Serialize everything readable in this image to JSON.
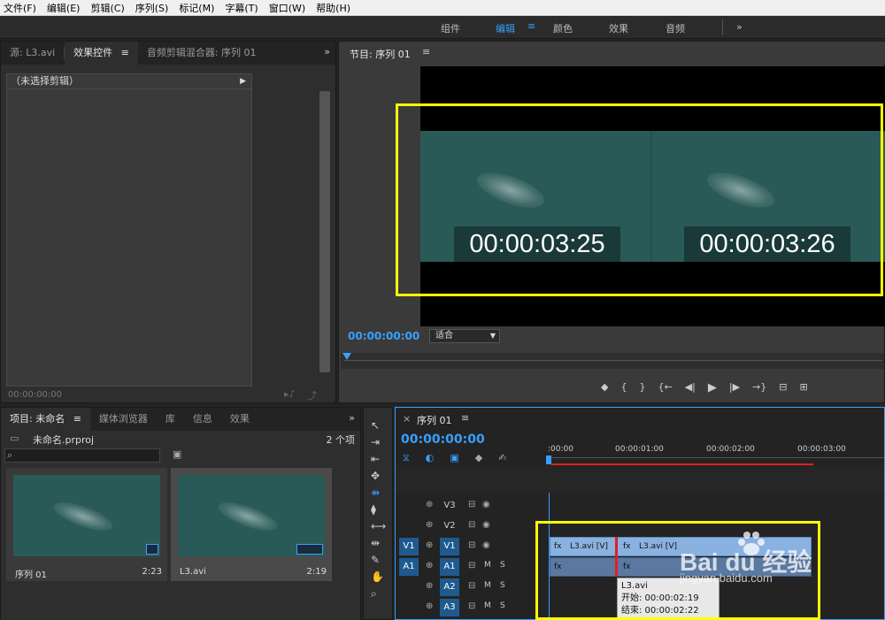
{
  "menu": [
    "文件(F)",
    "编辑(E)",
    "剪辑(C)",
    "序列(S)",
    "标记(M)",
    "字幕(T)",
    "窗口(W)",
    "帮助(H)"
  ],
  "workspaces": {
    "items": [
      "组件",
      "编辑",
      "颜色",
      "效果",
      "音频"
    ],
    "active": "编辑",
    "more": "»"
  },
  "source_panel": {
    "tabs": [
      "源: L3.avi",
      "效果控件",
      "音频剪辑混合器: 序列 01"
    ],
    "active_tab": "效果控件",
    "no_clip": "（未选择剪辑）",
    "timecode": "00:00:00:00",
    "more": "»",
    "menu_glyph": "≡"
  },
  "program_panel": {
    "title": "节目: 序列 01",
    "menu_glyph": "≡",
    "timecode": "00:00:00:00",
    "fit": "适合",
    "overlay_left": "00:00:03:25",
    "overlay_right": "00:00:03:26",
    "highlight_color": "#ffff00"
  },
  "project_panel": {
    "tabs": [
      "项目: 未命名",
      "媒体浏览器",
      "库",
      "信息",
      "效果"
    ],
    "active_tab": "项目: 未命名",
    "file": "未命名.prproj",
    "count": "2 个项",
    "more": "»",
    "menu_glyph": "≡",
    "items": [
      {
        "name": "序列 01",
        "duration": "2:23"
      },
      {
        "name": "L3.avi",
        "duration": "2:19"
      }
    ]
  },
  "timeline": {
    "close": "×",
    "menu_glyph": "≡",
    "title": "序列 01",
    "timecode": "00:00:00:00",
    "ruler": [
      ":00:00",
      "00:00:01:00",
      "00:00:02:00",
      "00:00:03:00"
    ],
    "tracks": [
      {
        "src": "",
        "name": "V3",
        "m": "",
        "s": ""
      },
      {
        "src": "",
        "name": "V2",
        "m": "",
        "s": ""
      },
      {
        "src": "V1",
        "name": "V1",
        "m": "",
        "s": ""
      },
      {
        "src": "A1",
        "name": "A1",
        "m": "M",
        "s": "S"
      },
      {
        "src": "",
        "name": "A2",
        "m": "M",
        "s": "S"
      },
      {
        "src": "",
        "name": "A3",
        "m": "M",
        "s": "S"
      }
    ],
    "clips": {
      "v1_a": "L3.avi [V]",
      "v1_b": "L3.avi [V]",
      "fx": "fx"
    },
    "tooltip": {
      "name": "L3.avi",
      "start": "开始: 00:00:02:19",
      "end": "结束: 00:00:02:22"
    },
    "accent": "#37a0ff",
    "cut_color": "#e02020"
  },
  "watermark": {
    "brand": "Bai du 经验",
    "url": "jingyan.baidu.com"
  }
}
